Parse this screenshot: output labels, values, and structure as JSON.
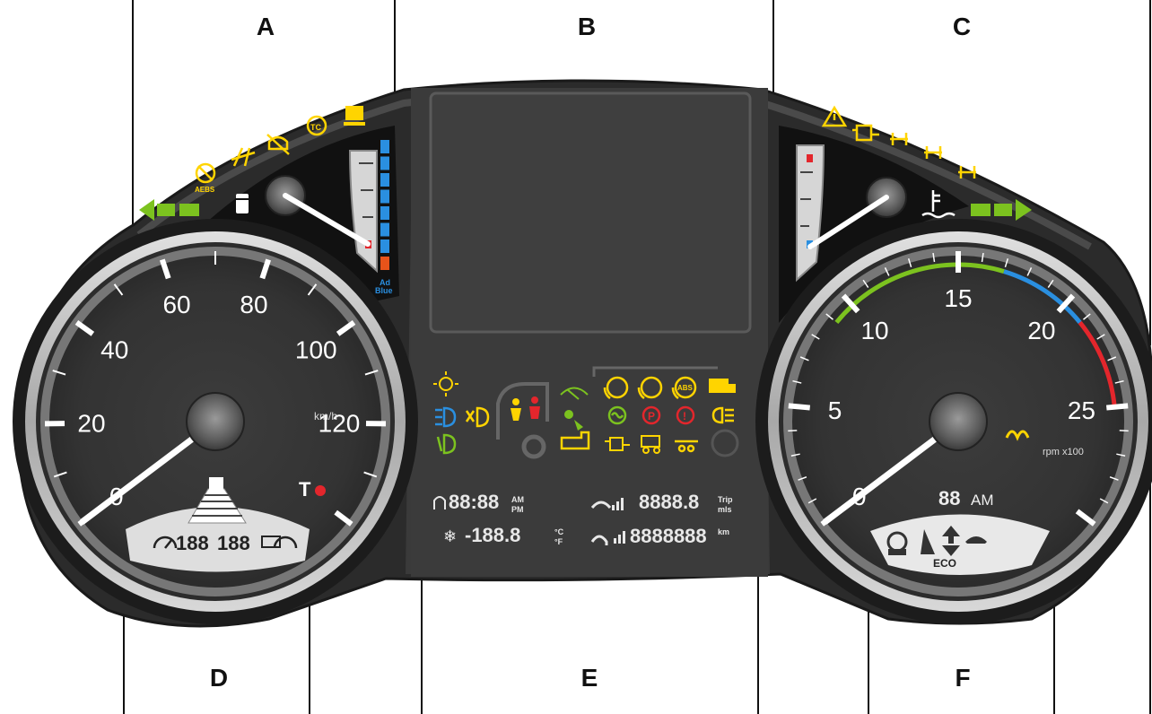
{
  "section_labels": {
    "A": "A",
    "B": "B",
    "C": "C",
    "D": "D",
    "E": "E",
    "F": "F"
  },
  "speedometer": {
    "ticks": [
      "0",
      "20",
      "40",
      "60",
      "80",
      "100",
      "120"
    ],
    "unit": "km/h",
    "needle_value_kmh": 0,
    "max_kmh": 140,
    "tachograph_label": "T",
    "odometer_left": "188",
    "odometer_right": "188"
  },
  "tachometer": {
    "ticks": [
      "0",
      "5",
      "10",
      "15",
      "20",
      "25"
    ],
    "unit": "rpm x100",
    "clock_segment": "88",
    "clock_suffix": "AM",
    "eco_label": "ECO",
    "needle_value": 0,
    "max_value": 30,
    "green_band": [
      9,
      17
    ],
    "blue_band": [
      17,
      21
    ],
    "red_band": [
      21,
      25
    ]
  },
  "center_display": {
    "time": "88:88",
    "am": "AM",
    "pm": "PM",
    "temperature": "-188.8",
    "celsius": "°C",
    "fahrenheit": "°F",
    "trip": "8888.8",
    "trip_label": "Trip",
    "miles_label": "mls",
    "odometer": "8888888",
    "km_label": "km"
  },
  "fuel_gauge": {
    "adblue_label_1": "Ad",
    "adblue_label_2": "Blue",
    "level_fraction": 0.0
  },
  "temp_gauge": {
    "level_fraction": 0.0
  },
  "warning_icons": {
    "aebs_text": "AEBS",
    "tc_text": "TC",
    "abs_text": "ABS"
  },
  "colors": {
    "panel": "#3a3a3a",
    "panel_dark": "#1e1e1e",
    "warning_yellow": "#ffd400",
    "indicator_green": "#7cc21f",
    "red": "#e3262c",
    "blue": "#2a8fe0",
    "lcd_grey": "#d0d0d0"
  }
}
